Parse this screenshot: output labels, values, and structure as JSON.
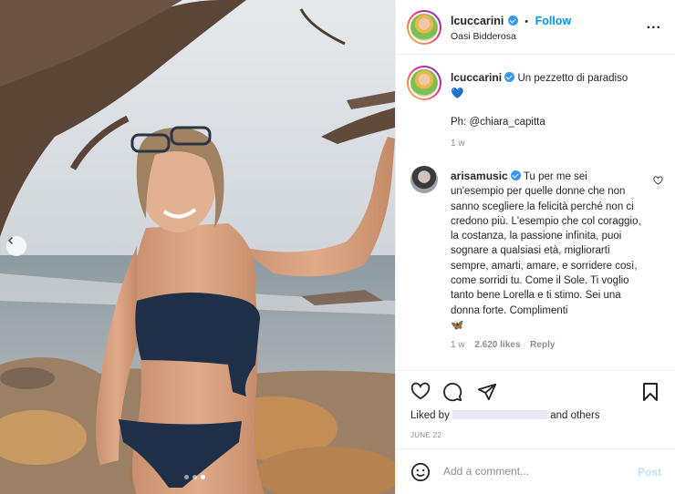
{
  "post": {
    "username": "lcuccarini",
    "follow_label": "Follow",
    "separator": "•",
    "location": "Oasi Bidderosa",
    "more_label": "...",
    "carousel_dots": 3,
    "active_dot": 3
  },
  "caption": {
    "username": "lcuccarini",
    "text": "Un pezzetto di paradiso",
    "emoji": "💙",
    "credit": "Ph: @chiara_capitta",
    "time": "1 w"
  },
  "comment": {
    "username": "arisamusic",
    "text": "Tu per me sei un'esempio per quelle donne che non sanno scegliere la felicità perché non ci credono più. L'esempio che col coraggio, la costanza, la passione infinita, puoi sognare a qualsiasi età, migliorarti sempre, amarti, amare, e sorridere così, come sorridi tu. Come il Sole. Ti voglio tanto bene Lorella e ti stimo. Sei una donna forte. Complimenti",
    "emoji": "🦋",
    "time": "1 w",
    "likes": "2.620 likes",
    "reply_label": "Reply"
  },
  "actions": {
    "liked_by_prefix": "Liked by",
    "liked_by_suffix": "and others",
    "date": "JUNE 22"
  },
  "add_comment": {
    "placeholder": "Add a comment...",
    "post_label": "Post"
  },
  "colors": {
    "link": "#0095f6",
    "verified": "#3897f0",
    "muted": "#8e8e8e",
    "post_disabled": "#c0dffd"
  }
}
